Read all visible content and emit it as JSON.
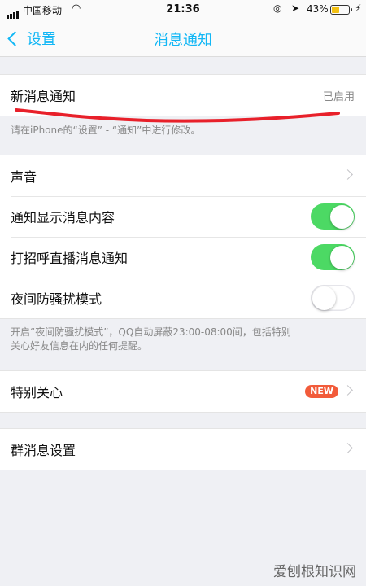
{
  "status_bar": {
    "carrier": "中国移动",
    "time": "21:36",
    "battery_percent": "43%",
    "battery_level": 0.43,
    "wifi_icon": "wifi-icon",
    "lock_icon": "orientation-lock-icon",
    "location_icon": "location-arrow-icon",
    "charging_icon": "charging-bolt-icon"
  },
  "nav": {
    "back_label": "设置",
    "title": "消息通知"
  },
  "colors": {
    "accent": "#12b7f5",
    "toggle_on": "#4cd964",
    "badge": "#f25b3a",
    "annotation": "#e8202a"
  },
  "new_message": {
    "label": "新消息通知",
    "status": "已启用",
    "note": "请在iPhone的“设置” - “通知”中进行修改。"
  },
  "settings": {
    "sound": "声音",
    "show_content": "通知显示消息内容",
    "show_content_on": true,
    "greet_live": "打招呼直播消息通知",
    "greet_live_on": true,
    "night_mode": "夜间防骚扰模式",
    "night_mode_on": false,
    "night_note_line1": "开启“夜间防骚扰模式”，QQ自动屏蔽23:00-08:00间，包括特别",
    "night_note_line2": "关心好友信息在内的任何提醒。"
  },
  "special_care": {
    "label": "特别关心",
    "badge": "NEW"
  },
  "group_settings": {
    "label": "群消息设置"
  },
  "watermark": "爱刨根知识网"
}
